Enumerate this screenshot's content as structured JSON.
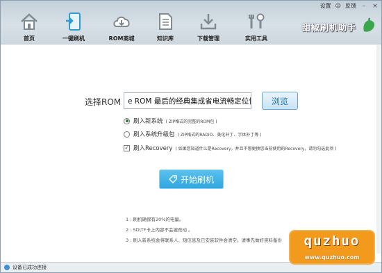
{
  "topbar": {
    "settings_label": "设置",
    "feedback_label": "反馈",
    "minimize": "–",
    "close": "×"
  },
  "nav": [
    {
      "label": "首页",
      "icon": "home-icon"
    },
    {
      "label": "一键刷机",
      "icon": "flash-phone-icon"
    },
    {
      "label": "ROM商城",
      "icon": "cloud-download-icon"
    },
    {
      "label": "知识库",
      "icon": "document-icon"
    },
    {
      "label": "下载管理",
      "icon": "download-icon"
    },
    {
      "label": "实用工具",
      "icon": "tools-icon"
    }
  ],
  "brand": {
    "name": "甜椒刷机助手"
  },
  "rom": {
    "label": "选择ROM",
    "value": "e ROM 最后的经典集成省电流畅定位快.zip",
    "browse_label": "浏览"
  },
  "options": {
    "new_system": {
      "label": "刷入新系统",
      "note": "( ZIP格式的完整的ROM包 )"
    },
    "upgrade": {
      "label": "刷入系统升级包",
      "note": "( ZIP格式的RADIO、美化补丁、字体补丁等 )"
    },
    "recovery": {
      "label": "刷入Recovery",
      "note": "( 如果您知道什么是Recovery，并且不想更换您当前使用的Recovery，请勿勾选此项 )"
    }
  },
  "start_label": "开始刷机",
  "notes": [
    "1 : 刷机确保有20%的电量。",
    "2 : SD\\TF卡上内容不会被改动 。",
    "3 : 刷入新系统会将联系人、短信息及已安装软件会清空。请事先做好资料备份"
  ],
  "status": {
    "text": "设备已成功连接"
  },
  "watermark": {
    "big": "quzhuo",
    "small": "www.quzhuo.com"
  }
}
